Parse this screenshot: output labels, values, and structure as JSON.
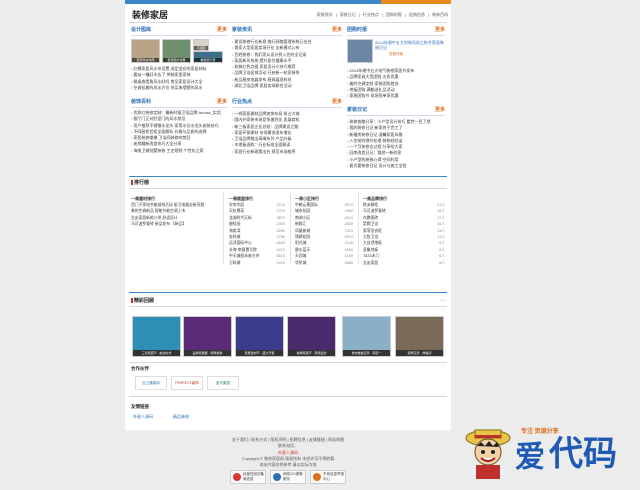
{
  "site": {
    "logo": "装修家居"
  },
  "topnav": [
    "家装资讯",
    "家装日记",
    "行业热点",
    "团购时报",
    "促销信息",
    "装饰百科"
  ],
  "cols": {
    "tuku": {
      "title": "设计图库",
      "more": "更多",
      "thumbs": [
        "装饰风水布局",
        "装修图片效果",
        "平面图",
        "精装修示意"
      ],
      "items": [
        "红棉家居风水市设置 选定适应的家居材料",
        "看似一幢好木去了 供装家里家装",
        "餐桌放墙角风水好吗 常见家居设计大全",
        "空调挂着的风水方位 你买来墙壁的风水"
      ]
    },
    "baike": {
      "title": "装饰百科",
      "more": "更多",
      "items": [
        "优质红装修定制：最新时候卫浴品牌 Aurora_实用",
        "客厅门正对卧室门的风水禁忌",
        "用户推荐不锈钢水龙头 家用水位水龙头安装技巧",
        "不同厨柜铝柜全面解析 价格与品质的选择",
        "家居装修楼梯 卫浴间装修的禁忌",
        "老房翻新改造技巧大全分享",
        "海南卫城别墅装修 工艺规划 个性化之家"
      ]
    },
    "zixun": {
      "title": "家装资讯",
      "more": "更多",
      "items": [
        "建设装修行业新规 推行网络管理系统已出台",
        "首家大型家居卖场开业 全新模式公布",
        "百姓装修：我们家从设计到入住的全记录",
        "家居新风系统 提升居住健康水平",
        "软装红色点缀 家居设计小技巧推荐",
        "品牌卫浴促销活动 开启新一轮家装季",
        "新品厨房电器发布 厨具展现科技",
        "湖北卫浴品牌 家居卖场联合活动"
      ]
    },
    "redian": {
      "title": "行业热点",
      "more": "更多",
      "items": [
        "一线家居建材品牌加快布局 抢占大城",
        "国内外家装市场竞争激烈化 发展商机",
        "新三板家居企业总结：品牌建设之路",
        "家居环保建材 市场需求逐年增长",
        "卫浴品牌推出高端系列 产品升级",
        "木地板选购：行业标准全面解读",
        "家居行业新政策出台 规范市场秩序"
      ]
    },
    "tuangou": {
      "title": "团购时报",
      "more": "更多",
      "feature": "2014年湘中五大时装风尚之秋冬家居装修日记",
      "feature_link": "查看详情",
      "items": [
        "2014年湘中五大电气装修家居节发布",
        "品牌家具大型团购 五折优惠",
        "美的空调定制 家装团购首选",
        "地板团购 满额送礼品活动",
        "家装团购节 现场签单享优惠"
      ]
    },
    "riji": {
      "title": "家装日记",
      "more": "更多",
      "items": [
        "装修攻略分享：小户型设计技巧 看完一目了然",
        "我的装修日记 新家终于完工了",
        "新婚房装修日记 温馨家居风格",
        "入住前的细节处理 装修经验谈",
        "一个月装修全过程 分享给大家",
        "旧房改造日记：焕然一新的家",
        "小户型的装修心得 空间利用",
        "复式楼装修日记 设计与施工全程"
      ]
    }
  },
  "rank": {
    "title": "排行榜",
    "cols": [
      {
        "head": "一周建材排行",
        "rows": [
          [
            "西门子家电节能减排活动 厨卫电器全新亮相",
            ""
          ],
          [
            "美的空调新品 智能节能空调上市",
            ""
          ],
          [
            "全友家居新款沙发 舒适设计",
            ""
          ],
          [
            "马可波罗瓷砖 新品发布 【新品】",
            ""
          ]
        ]
      },
      {
        "head": "一周楼盘排行",
        "rows": [
          [
            "学府华庭",
            "3716"
          ],
          [
            "天虹景苑",
            "1374"
          ],
          [
            "龙湖时代天街",
            "3670"
          ],
          [
            "碧桂园",
            "2300"
          ],
          [
            "海棠湾",
            "5260"
          ],
          [
            "金科城",
            "2780"
          ],
          [
            "远洋国际中心",
            "4620"
          ],
          [
            "长海·南昌壹号院",
            "3470"
          ],
          [
            "中天城投未来方舟",
            "6610"
          ],
          [
            "万科城",
            "1910"
          ]
        ]
      },
      {
        "head": "一周小区排行",
        "rows": [
          [
            "中粮云景国际",
            "2670"
          ],
          [
            "城市花园",
            "1962"
          ],
          [
            "南湖小区",
            "4010"
          ],
          [
            "新都汇",
            "2830"
          ],
          [
            "凤凰新城",
            "7010"
          ],
          [
            "锦绣花园",
            "9210"
          ],
          [
            "阳光城",
            "2130"
          ],
          [
            "碧水蓝天",
            "1900"
          ],
          [
            "天润城",
            "4150"
          ],
          [
            "华侨城",
            "3560"
          ]
        ]
      },
      {
        "head": "一周品牌排行",
        "rows": [
          [
            "欧派橱柜",
            "21人"
          ],
          [
            "马可波罗瓷砖",
            "19人"
          ],
          [
            "东鹏瓷砖",
            "17人"
          ],
          [
            "箭牌卫浴",
            "15人"
          ],
          [
            "索菲亚衣柜",
            "13人"
          ],
          [
            "九牧卫浴",
            "11人"
          ],
          [
            "大自然地板",
            "9人"
          ],
          [
            "圣象地板",
            "8人"
          ],
          [
            "TATA木门",
            "6人"
          ],
          [
            "全友家居",
            "5人"
          ]
        ]
      }
    ]
  },
  "promo": {
    "title": "精彩回顾",
    "items": [
      "三月家装节 · 启动仪式",
      "品牌家居展 · 特惠抢购",
      "家居建材节 · 盛大开幕",
      "春季家装节 · 现场签约",
      "城市楼盘实景 · 项目一",
      "别墅实景 · 样板间"
    ]
  },
  "partners": {
    "title": "合作伙伴",
    "items": [
      "业之峰装饰",
      "PERFECT装饰",
      "蓝鸟集团"
    ]
  },
  "links": {
    "title": "友情链接",
    "items": [
      "外星人源码",
      "精品装修"
    ]
  },
  "footer": {
    "lines": [
      "关于我们 | 联系方式 | 版权声明 | 招聘信息 | 友情链接 | 网站地图",
      "联系电话：",
      "外星人源码",
      "Copyright © 装修家居网 版权所有 未经许可不得转载",
      "本站内容仅供参考 请以实际为准"
    ],
    "badges": [
      "经营性网站备案信息",
      "网络110报警服务",
      "不良信息举报中心"
    ]
  },
  "watermark": {
    "text1": "爱",
    "text2": "代码",
    "text3": "专注 资源分享"
  }
}
